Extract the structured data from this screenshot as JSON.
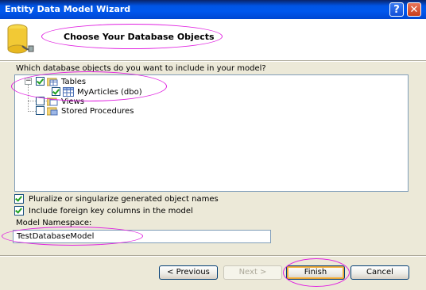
{
  "window": {
    "title": "Entity Data Model Wizard"
  },
  "titlebar": {
    "help_glyph": "?",
    "close_glyph": "✕"
  },
  "header": {
    "title": "Choose Your Database Objects",
    "icon": "database-icon"
  },
  "question": "Which database objects do you want to include in your model?",
  "tree": {
    "items": [
      {
        "label": "Tables",
        "checked": true,
        "expanded": true,
        "icon": "folder-table-icon"
      },
      {
        "label": "MyArticles (dbo)",
        "checked": true,
        "icon": "table-icon"
      },
      {
        "label": "Views",
        "checked": false,
        "icon": "folder-view-icon"
      },
      {
        "label": "Stored Procedures",
        "checked": false,
        "icon": "folder-proc-icon"
      }
    ],
    "expander_glyph": "−"
  },
  "options": {
    "pluralize": {
      "label": "Pluralize or singularize generated object names",
      "checked": true
    },
    "foreign_keys": {
      "label": "Include foreign key columns in the model",
      "checked": true
    }
  },
  "namespace": {
    "label": "Model Namespace:",
    "value": "TestDatabaseModel"
  },
  "buttons": {
    "previous": "< Previous",
    "next": "Next >",
    "finish": "Finish",
    "cancel": "Cancel"
  },
  "colors": {
    "annotation": "#E020E0",
    "titlebar": "#0054E3",
    "dialog_bg": "#ECE9D8"
  }
}
